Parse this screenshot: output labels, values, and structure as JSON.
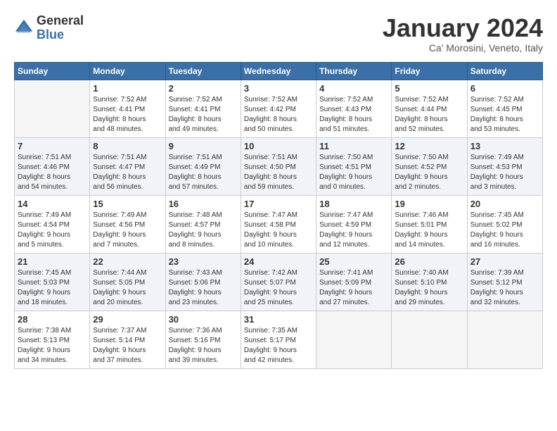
{
  "logo": {
    "general": "General",
    "blue": "Blue"
  },
  "title": "January 2024",
  "location": "Ca' Morosini, Veneto, Italy",
  "headers": [
    "Sunday",
    "Monday",
    "Tuesday",
    "Wednesday",
    "Thursday",
    "Friday",
    "Saturday"
  ],
  "weeks": [
    [
      {
        "day": "",
        "info": ""
      },
      {
        "day": "1",
        "info": "Sunrise: 7:52 AM\nSunset: 4:41 PM\nDaylight: 8 hours\nand 48 minutes."
      },
      {
        "day": "2",
        "info": "Sunrise: 7:52 AM\nSunset: 4:41 PM\nDaylight: 8 hours\nand 49 minutes."
      },
      {
        "day": "3",
        "info": "Sunrise: 7:52 AM\nSunset: 4:42 PM\nDaylight: 8 hours\nand 50 minutes."
      },
      {
        "day": "4",
        "info": "Sunrise: 7:52 AM\nSunset: 4:43 PM\nDaylight: 8 hours\nand 51 minutes."
      },
      {
        "day": "5",
        "info": "Sunrise: 7:52 AM\nSunset: 4:44 PM\nDaylight: 8 hours\nand 52 minutes."
      },
      {
        "day": "6",
        "info": "Sunrise: 7:52 AM\nSunset: 4:45 PM\nDaylight: 8 hours\nand 53 minutes."
      }
    ],
    [
      {
        "day": "7",
        "info": "Sunrise: 7:51 AM\nSunset: 4:46 PM\nDaylight: 8 hours\nand 54 minutes."
      },
      {
        "day": "8",
        "info": "Sunrise: 7:51 AM\nSunset: 4:47 PM\nDaylight: 8 hours\nand 56 minutes."
      },
      {
        "day": "9",
        "info": "Sunrise: 7:51 AM\nSunset: 4:49 PM\nDaylight: 8 hours\nand 57 minutes."
      },
      {
        "day": "10",
        "info": "Sunrise: 7:51 AM\nSunset: 4:50 PM\nDaylight: 8 hours\nand 59 minutes."
      },
      {
        "day": "11",
        "info": "Sunrise: 7:50 AM\nSunset: 4:51 PM\nDaylight: 9 hours\nand 0 minutes."
      },
      {
        "day": "12",
        "info": "Sunrise: 7:50 AM\nSunset: 4:52 PM\nDaylight: 9 hours\nand 2 minutes."
      },
      {
        "day": "13",
        "info": "Sunrise: 7:49 AM\nSunset: 4:53 PM\nDaylight: 9 hours\nand 3 minutes."
      }
    ],
    [
      {
        "day": "14",
        "info": "Sunrise: 7:49 AM\nSunset: 4:54 PM\nDaylight: 9 hours\nand 5 minutes."
      },
      {
        "day": "15",
        "info": "Sunrise: 7:49 AM\nSunset: 4:56 PM\nDaylight: 9 hours\nand 7 minutes."
      },
      {
        "day": "16",
        "info": "Sunrise: 7:48 AM\nSunset: 4:57 PM\nDaylight: 9 hours\nand 8 minutes."
      },
      {
        "day": "17",
        "info": "Sunrise: 7:47 AM\nSunset: 4:58 PM\nDaylight: 9 hours\nand 10 minutes."
      },
      {
        "day": "18",
        "info": "Sunrise: 7:47 AM\nSunset: 4:59 PM\nDaylight: 9 hours\nand 12 minutes."
      },
      {
        "day": "19",
        "info": "Sunrise: 7:46 AM\nSunset: 5:01 PM\nDaylight: 9 hours\nand 14 minutes."
      },
      {
        "day": "20",
        "info": "Sunrise: 7:45 AM\nSunset: 5:02 PM\nDaylight: 9 hours\nand 16 minutes."
      }
    ],
    [
      {
        "day": "21",
        "info": "Sunrise: 7:45 AM\nSunset: 5:03 PM\nDaylight: 9 hours\nand 18 minutes."
      },
      {
        "day": "22",
        "info": "Sunrise: 7:44 AM\nSunset: 5:05 PM\nDaylight: 9 hours\nand 20 minutes."
      },
      {
        "day": "23",
        "info": "Sunrise: 7:43 AM\nSunset: 5:06 PM\nDaylight: 9 hours\nand 23 minutes."
      },
      {
        "day": "24",
        "info": "Sunrise: 7:42 AM\nSunset: 5:07 PM\nDaylight: 9 hours\nand 25 minutes."
      },
      {
        "day": "25",
        "info": "Sunrise: 7:41 AM\nSunset: 5:09 PM\nDaylight: 9 hours\nand 27 minutes."
      },
      {
        "day": "26",
        "info": "Sunrise: 7:40 AM\nSunset: 5:10 PM\nDaylight: 9 hours\nand 29 minutes."
      },
      {
        "day": "27",
        "info": "Sunrise: 7:39 AM\nSunset: 5:12 PM\nDaylight: 9 hours\nand 32 minutes."
      }
    ],
    [
      {
        "day": "28",
        "info": "Sunrise: 7:38 AM\nSunset: 5:13 PM\nDaylight: 9 hours\nand 34 minutes."
      },
      {
        "day": "29",
        "info": "Sunrise: 7:37 AM\nSunset: 5:14 PM\nDaylight: 9 hours\nand 37 minutes."
      },
      {
        "day": "30",
        "info": "Sunrise: 7:36 AM\nSunset: 5:16 PM\nDaylight: 9 hours\nand 39 minutes."
      },
      {
        "day": "31",
        "info": "Sunrise: 7:35 AM\nSunset: 5:17 PM\nDaylight: 9 hours\nand 42 minutes."
      },
      {
        "day": "",
        "info": ""
      },
      {
        "day": "",
        "info": ""
      },
      {
        "day": "",
        "info": ""
      }
    ]
  ]
}
